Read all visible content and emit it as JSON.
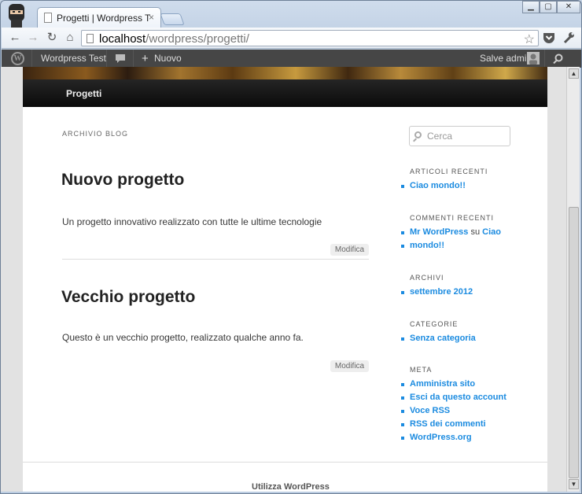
{
  "browser": {
    "tab_title": "Progetti | Wordpress T",
    "tab_close": "×",
    "url_host": "localhost",
    "url_path": "/wordpress/progetti/",
    "window_controls": {
      "minimize": "▁",
      "maximize": "▢",
      "close": "✕"
    }
  },
  "adminbar": {
    "site_name": "Wordpress Test",
    "new_label": "Nuovo",
    "greeting": "Salve admin"
  },
  "nav": {
    "item": "Progetti"
  },
  "archive_title": "ARCHIVIO BLOG",
  "posts": [
    {
      "title": "Nuovo progetto",
      "excerpt": "Un progetto innovativo realizzato con tutte le ultime tecnologie",
      "edit": "Modifica"
    },
    {
      "title": "Vecchio progetto",
      "excerpt": "Questo è un vecchio progetto, realizzato qualche anno fa.",
      "edit": "Modifica"
    }
  ],
  "sidebar": {
    "search_placeholder": "Cerca",
    "recent_posts": {
      "title": "ARTICOLI RECENTI",
      "items": [
        "Ciao mondo!!"
      ]
    },
    "recent_comments": {
      "title": "COMMENTI RECENTI",
      "author": "Mr WordPress",
      "conj": "su",
      "post_line1": "Ciao",
      "post_line2": "mondo!!"
    },
    "archives": {
      "title": "ARCHIVI",
      "items": [
        "settembre 2012"
      ]
    },
    "categories": {
      "title": "CATEGORIE",
      "items": [
        "Senza categoria"
      ]
    },
    "meta": {
      "title": "META",
      "items": [
        "Amministra sito",
        "Esci da questo account",
        "Voce RSS",
        "RSS dei commenti",
        "WordPress.org"
      ]
    }
  },
  "footer": {
    "credit": "Utilizza WordPress"
  }
}
